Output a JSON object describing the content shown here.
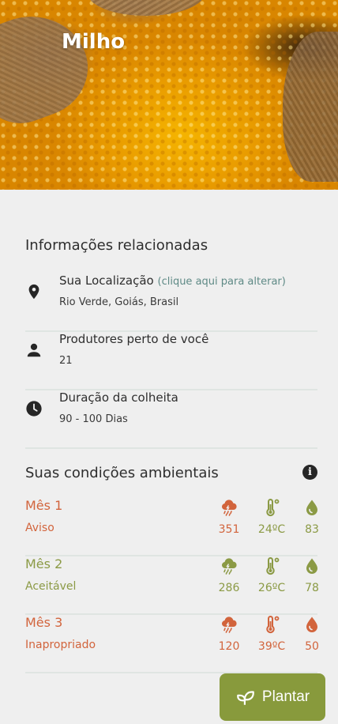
{
  "crop": {
    "name": "Milho"
  },
  "related": {
    "title": "Informações relacionadas",
    "location": {
      "label": "Sua Localização",
      "hint": "(clique aqui para alterar)",
      "value": "Rio Verde, Goiás, Brasil",
      "icon": "map-pin-icon"
    },
    "producers": {
      "label": "Produtores perto de você",
      "value": "21",
      "icon": "person-icon"
    },
    "harvest": {
      "label": "Duração da colheita",
      "value": "90 - 100 Dias",
      "icon": "clock-icon"
    }
  },
  "conditions": {
    "title": "Suas condições ambientais",
    "info_icon": "info-icon",
    "colors": {
      "warning": "#d2643c",
      "acceptable": "#8b9a45",
      "inappropriate": "#d2643c"
    },
    "months": [
      {
        "name": "Mês 1",
        "status": "Aviso",
        "rain": "351",
        "temp": "24ºC",
        "humidity": "83",
        "rain_color": "#d2643c",
        "temp_color": "#8b9a45",
        "humidity_color": "#8b9a45",
        "text_color": "#d2643c"
      },
      {
        "name": "Mês 2",
        "status": "Aceitável",
        "rain": "286",
        "temp": "26ºC",
        "humidity": "78",
        "rain_color": "#8b9a45",
        "temp_color": "#8b9a45",
        "humidity_color": "#8b9a45",
        "text_color": "#8b9a45"
      },
      {
        "name": "Mês 3",
        "status": "Inapropriado",
        "rain": "120",
        "temp": "39ºC",
        "humidity": "50",
        "rain_color": "#d2643c",
        "temp_color": "#d2643c",
        "humidity_color": "#d2643c",
        "text_color": "#d2643c"
      }
    ]
  },
  "action": {
    "label": "Plantar",
    "icon": "sprout-icon",
    "color": "#889a3c"
  }
}
